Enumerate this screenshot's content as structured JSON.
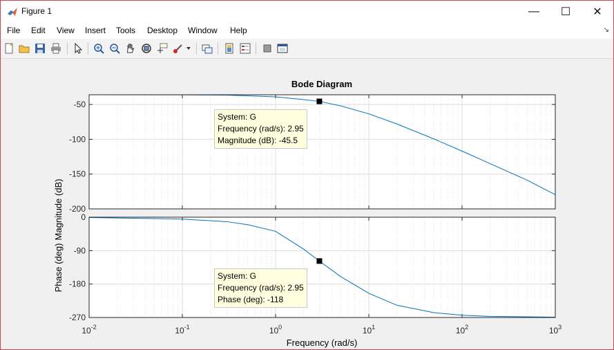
{
  "window": {
    "title": "Figure 1",
    "controls": {
      "minimize": "—",
      "maximize": "☐",
      "close": "✕"
    }
  },
  "menu": {
    "items": [
      "File",
      "Edit",
      "View",
      "Insert",
      "Tools",
      "Desktop",
      "Window",
      "Help"
    ],
    "corner_glyph": "↘"
  },
  "toolbar": {
    "buttons": [
      "new-figure",
      "open-file",
      "save",
      "print",
      "edit-plot-pointer",
      "zoom-in",
      "zoom-out",
      "pan",
      "rotate-3d",
      "data-cursor",
      "brush",
      "link-plot",
      "insert-colorbar",
      "insert-legend",
      "hide-plot-tools",
      "show-plot-tools"
    ]
  },
  "chart_data": {
    "type": "line",
    "title": "Bode Diagram",
    "xlabel": "Frequency  (rad/s)",
    "x_scale": "log",
    "xlim": [
      0.01,
      1000
    ],
    "x_ticks": [
      {
        "base": "10",
        "exp": "-2"
      },
      {
        "base": "10",
        "exp": "-1"
      },
      {
        "base": "10",
        "exp": "0"
      },
      {
        "base": "10",
        "exp": "1"
      },
      {
        "base": "10",
        "exp": "2"
      },
      {
        "base": "10",
        "exp": "3"
      }
    ],
    "grid": true,
    "series_color": "#0072bd",
    "panels": [
      {
        "name": "magnitude",
        "ylabel": "Magnitude (dB)",
        "ylim": [
          -200,
          -36
        ],
        "y_ticks": [
          "-50",
          "-100",
          "-150",
          "-200"
        ],
        "y_tick_values": [
          -50,
          -100,
          -150,
          -200
        ],
        "points": [
          [
            0.01,
            -36.0
          ],
          [
            0.1,
            -36.1
          ],
          [
            0.3,
            -36.5
          ],
          [
            1,
            -39.0
          ],
          [
            2,
            -42.9
          ],
          [
            2.95,
            -45.5
          ],
          [
            5,
            -52.0
          ],
          [
            10,
            -63.4
          ],
          [
            20,
            -78.0
          ],
          [
            50,
            -99.5
          ],
          [
            100,
            -117.0
          ],
          [
            200,
            -135.0
          ],
          [
            500,
            -158.8
          ],
          [
            1000,
            -179.6
          ]
        ],
        "marker": [
          2.95,
          -45.5
        ],
        "datatip": {
          "system": "System: G",
          "frequency": "Frequency (rad/s): 2.95",
          "value": "Magnitude (dB): -45.5"
        }
      },
      {
        "name": "phase",
        "ylabel": "Phase (deg)",
        "ylim": [
          -270,
          0
        ],
        "y_ticks": [
          "0",
          "-90",
          "-180",
          "-270"
        ],
        "y_tick_values": [
          0,
          -90,
          -180,
          -270
        ],
        "points": [
          [
            0.01,
            -1
          ],
          [
            0.1,
            -5
          ],
          [
            0.3,
            -12
          ],
          [
            0.5,
            -20
          ],
          [
            1,
            -38
          ],
          [
            2,
            -86
          ],
          [
            2.95,
            -118
          ],
          [
            5,
            -160
          ],
          [
            10,
            -205
          ],
          [
            20,
            -237
          ],
          [
            50,
            -257
          ],
          [
            100,
            -264
          ],
          [
            200,
            -267
          ],
          [
            1000,
            -269
          ]
        ],
        "marker": [
          2.95,
          -118
        ],
        "datatip": {
          "system": "System: G",
          "frequency": "Frequency (rad/s): 2.95",
          "value": "Phase (deg): -118"
        }
      }
    ]
  }
}
